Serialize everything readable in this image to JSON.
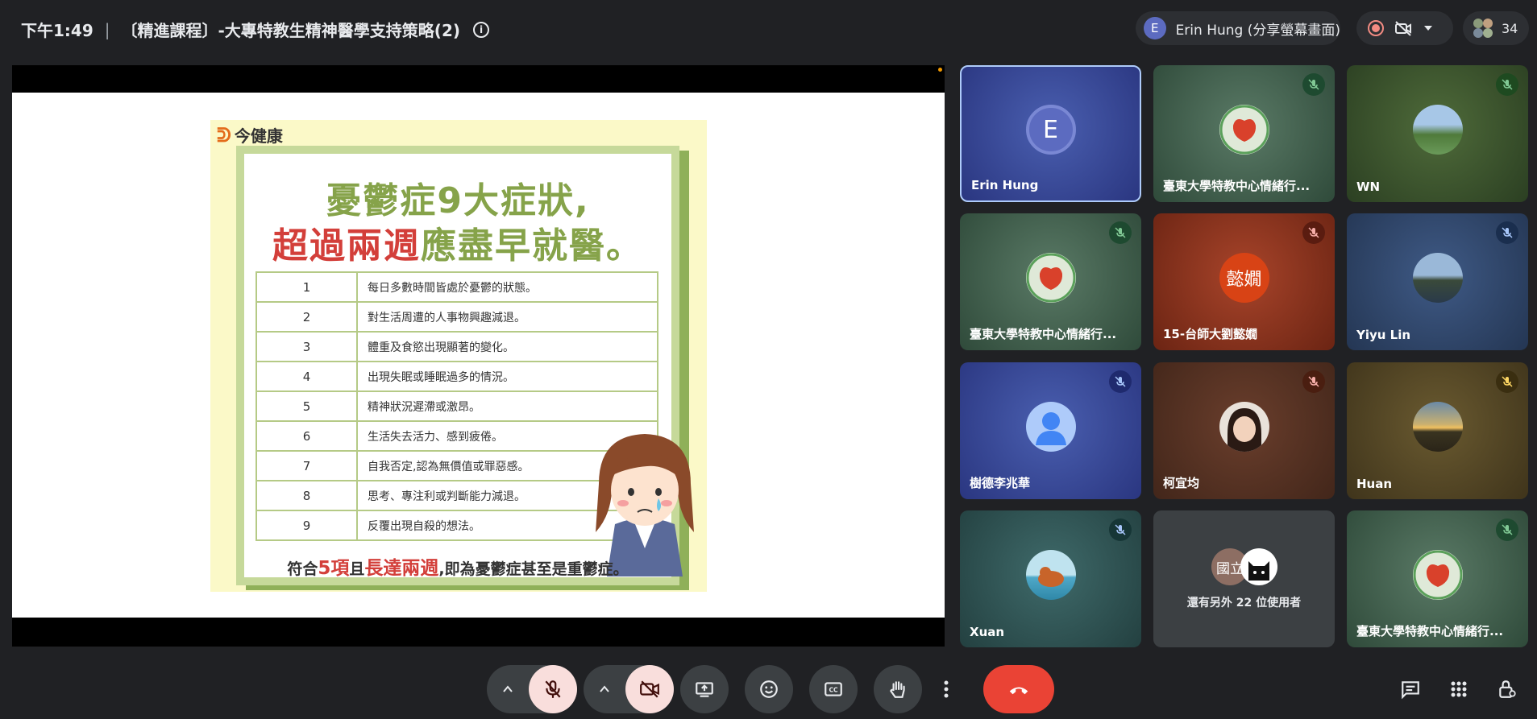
{
  "topbar": {
    "time": "下午1:49",
    "separator": "|",
    "meeting_title": "〔精進課程〕-大專特教生精神醫學支持策略(2)",
    "info_icon": "info-icon",
    "presenter_initial": "E",
    "presenter_label": "Erin Hung (分享螢幕畫面)",
    "participant_count": "34"
  },
  "slide": {
    "logo_text": "今健康",
    "headline_line1": "憂鬱症9大症狀,",
    "headline_line2_red": "超過兩週",
    "headline_line2_green": "應盡早就醫。",
    "rows": [
      {
        "num": "1",
        "text": "每日多數時間皆處於憂鬱的狀態。"
      },
      {
        "num": "2",
        "text": "對生活周遭的人事物興趣減退。"
      },
      {
        "num": "3",
        "text": "體重及食慾出現顯著的變化。"
      },
      {
        "num": "4",
        "text": "出現失眠或睡眠過多的情況。"
      },
      {
        "num": "5",
        "text": "精神狀況遲滯或激昂。"
      },
      {
        "num": "6",
        "text": "生活失去活力、感到疲倦。"
      },
      {
        "num": "7",
        "text": "自我否定,認為無價值或罪惡感。"
      },
      {
        "num": "8",
        "text": "思考、專注利或判斷能力減退。"
      },
      {
        "num": "9",
        "text": "反覆出現自殺的想法。"
      }
    ],
    "footer_a": "符合",
    "footer_b": "5項",
    "footer_c": "且",
    "footer_d": "長達兩週",
    "footer_e": ",即為憂鬱症甚至是重鬱症。"
  },
  "tiles": [
    {
      "name": "Erin Hung",
      "initial": "E"
    },
    {
      "name": "臺東大學特教中心情緒行..."
    },
    {
      "name": "WN"
    },
    {
      "name": "臺東大學特教中心情緒行..."
    },
    {
      "name": "15-台師大劉懿嫺",
      "avatar_text": "懿嫺"
    },
    {
      "name": "Yiyu Lin"
    },
    {
      "name": "樹德李兆華"
    },
    {
      "name": "柯宜均"
    },
    {
      "name": "Huan"
    },
    {
      "name": "Xuan"
    },
    {
      "name": "還有另外 22 位使用者",
      "avatar_text": "國立"
    },
    {
      "name": "臺東大學特教中心情緒行..."
    }
  ],
  "controls": {
    "mic_icon": "mic-off-icon",
    "cam_icon": "camera-off-icon",
    "present_icon": "present-screen-icon",
    "emoji_icon": "emoji-icon",
    "captions_icon": "captions-icon",
    "hand_icon": "raise-hand-icon",
    "more_icon": "more-options-icon",
    "leave_icon": "leave-call-icon",
    "chat_icon": "chat-icon",
    "activities_icon": "activities-icon",
    "host_icon": "host-controls-icon"
  },
  "colors": {
    "background": "#202124",
    "leave_red": "#ea4335",
    "muted_red_bg": "#f9dedc",
    "slide_green": "#86a34a",
    "slide_red": "#d33f3a"
  }
}
